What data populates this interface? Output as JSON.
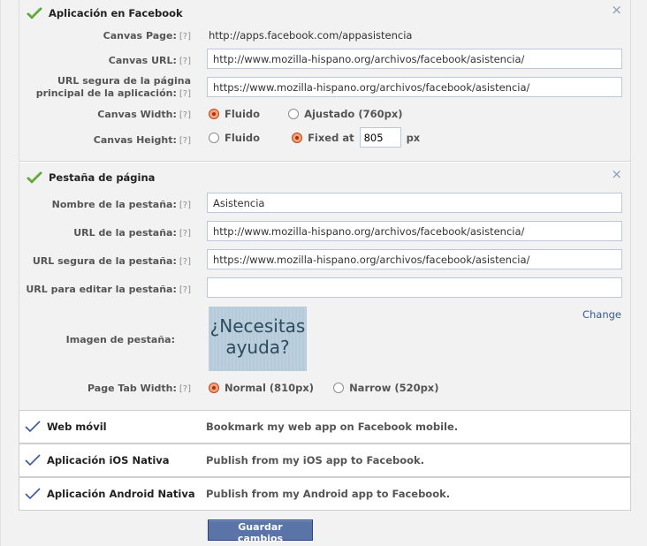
{
  "facebook_app": {
    "title": "Aplicación en Facebook",
    "close": "×",
    "canvas_page": {
      "label": "Canvas Page:",
      "help": "[?]",
      "value": "http://apps.facebook.com/appasistencia"
    },
    "canvas_url": {
      "label": "Canvas URL:",
      "help": "[?]",
      "value": "http://www.mozilla-hispano.org/archivos/facebook/asistencia/"
    },
    "secure_url": {
      "label_line1": "URL segura de la página",
      "label_line2": "principal de la aplicación:",
      "help": "[?]",
      "value": "https://www.mozilla-hispano.org/archivos/facebook/asistencia/"
    },
    "canvas_width": {
      "label": "Canvas Width:",
      "help": "[?]",
      "option1": "Fluido",
      "option2": "Ajustado (760px)",
      "selected": "Fluido"
    },
    "canvas_height": {
      "label": "Canvas Height:",
      "help": "[?]",
      "option1": "Fluido",
      "option2": "Fixed at",
      "value": "805",
      "unit": "px",
      "selected": "Fixed at"
    }
  },
  "page_tab": {
    "title": "Pestaña de página",
    "close": "×",
    "tab_name": {
      "label": "Nombre de la pestaña:",
      "help": "[?]",
      "value": "Asistencia"
    },
    "tab_url": {
      "label": "URL de la pestaña:",
      "help": "[?]",
      "value": "http://www.mozilla-hispano.org/archivos/facebook/asistencia/"
    },
    "secure_tab_url": {
      "label": "URL segura de la pestaña:",
      "help": "[?]",
      "value": "https://www.mozilla-hispano.org/archivos/facebook/asistencia/"
    },
    "edit_url": {
      "label": "URL para editar la pestaña:",
      "help": "[?]",
      "value": ""
    },
    "tab_image": {
      "label": "Imagen de pestaña:",
      "image_line1": "¿Necesitas",
      "image_line2": "ayuda?",
      "change": "Change"
    },
    "tab_width": {
      "label": "Page Tab Width:",
      "help": "[?]",
      "option1": "Normal (810px)",
      "option2": "Narrow (520px)",
      "selected": "Normal (810px)"
    }
  },
  "platforms": [
    {
      "name": "Web móvil",
      "desc": "Bookmark my web app on Facebook mobile."
    },
    {
      "name": "Aplicación iOS Nativa",
      "desc": "Publish from my iOS app to Facebook."
    },
    {
      "name": "Aplicación Android Nativa",
      "desc": "Publish from my Android app to Facebook."
    }
  ],
  "save_label": "Guardar cambios",
  "colors": {
    "accent": "#3b5998",
    "check_green": "#5aa13a",
    "button": "#5b74a8"
  }
}
